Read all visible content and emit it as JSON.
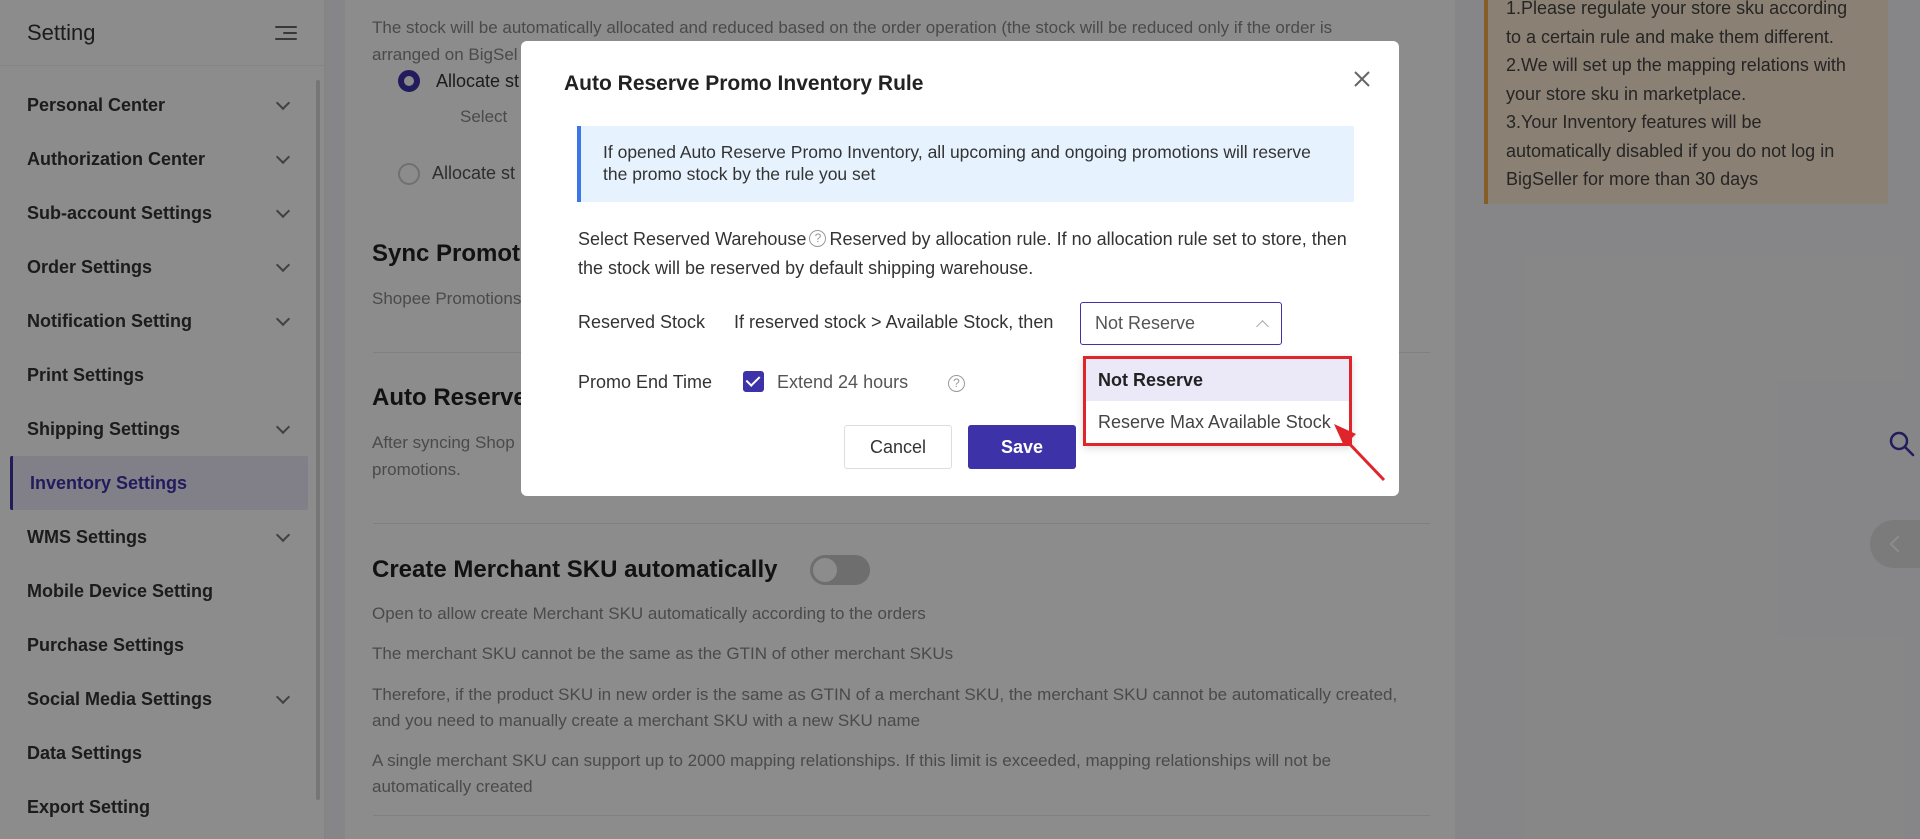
{
  "sidebar": {
    "title": "Setting",
    "items": [
      {
        "label": "Personal Center",
        "expandable": true,
        "active": false
      },
      {
        "label": "Authorization Center",
        "expandable": true,
        "active": false
      },
      {
        "label": "Sub-account Settings",
        "expandable": true,
        "active": false
      },
      {
        "label": "Order Settings",
        "expandable": true,
        "active": false
      },
      {
        "label": "Notification Setting",
        "expandable": true,
        "active": false
      },
      {
        "label": "Print Settings",
        "expandable": false,
        "active": false
      },
      {
        "label": "Shipping Settings",
        "expandable": true,
        "active": false
      },
      {
        "label": "Inventory Settings",
        "expandable": false,
        "active": true
      },
      {
        "label": "WMS Settings",
        "expandable": true,
        "active": false
      },
      {
        "label": "Mobile Device Setting",
        "expandable": false,
        "active": false
      },
      {
        "label": "Purchase Settings",
        "expandable": false,
        "active": false
      },
      {
        "label": "Social Media Settings",
        "expandable": true,
        "active": false
      },
      {
        "label": "Data Settings",
        "expandable": false,
        "active": false
      },
      {
        "label": "Export Setting",
        "expandable": false,
        "active": false
      }
    ]
  },
  "main": {
    "stock_desc_1": "The stock will be automatically allocated and reduced based on the order operation (the stock will be reduced only if the order is",
    "stock_desc_2": "arranged on BigSel",
    "allocate_option_1": "Allocate st",
    "select_text": "Select",
    "allocate_option_2": "Allocate st",
    "sync_heading": "Sync Promotio",
    "sync_desc": "Shopee Promotions",
    "auto_reserve_heading": "Auto Reserve",
    "auto_reserve_desc_1": "After syncing Shop",
    "auto_reserve_desc_2": "promotions.",
    "create_sku_heading": "Create Merchant SKU automatically",
    "create_sku_lines": [
      "Open to allow create Merchant SKU automatically according to the orders",
      "The merchant SKU cannot be the same as the GTIN of other merchant SKUs",
      "Therefore, if the product SKU in new order is the same as GTIN of a merchant SKU, the merchant SKU cannot be automatically created,",
      "and you need to manually create a merchant SKU with a new SKU name",
      "A single merchant SKU can support up to 2000 mapping relationships. If this limit is exceeded, mapping relationships will not be",
      "automatically created"
    ]
  },
  "note": {
    "lines": [
      "1.Please regulate your store sku according",
      "to a certain rule and make them different.",
      "2.We will set up the mapping relations with",
      "your store sku in marketplace.",
      "3.Your Inventory features will be",
      "automatically disabled if you do not log in",
      "BigSeller for more than 30 days"
    ]
  },
  "modal": {
    "title": "Auto Reserve Promo Inventory Rule",
    "info": "If opened Auto Reserve Promo Inventory, all upcoming and ongoing promotions will reserve the promo stock by the rule you set",
    "warehouse_label": "Select Reserved Warehouse",
    "warehouse_desc": "Reserved by allocation rule. If no allocation rule set to store, then the stock will be reserved by default shipping warehouse.",
    "reserved_stock_label": "Reserved Stock",
    "reserved_stock_condition": "If reserved stock > Available Stock, then",
    "select_value": "Not Reserve",
    "promo_end_label": "Promo End Time",
    "extend_label": "Extend 24 hours",
    "cancel_label": "Cancel",
    "save_label": "Save"
  },
  "dropdown": {
    "options": [
      "Not Reserve",
      "Reserve Max Available Stock"
    ],
    "selected": "Not Reserve"
  },
  "colors": {
    "primary": "#3e32a8",
    "highlight_border": "#e0242b",
    "info_bg": "#e6f2fd",
    "note_bg": "#fde9d3"
  }
}
